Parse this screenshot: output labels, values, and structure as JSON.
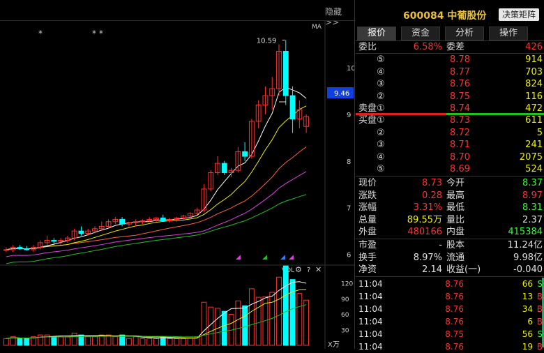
{
  "chart": {
    "hide_label": "隐藏>>",
    "ma_label": "MA",
    "stars": [
      "*",
      "* *"
    ],
    "max_label": "10.59",
    "current_price_box": "9.46",
    "price_axis": [
      "10",
      "9",
      "8",
      "7",
      "6"
    ],
    "vol_label": "VOL",
    "vol_axis": [
      "120",
      "90",
      "60",
      "30"
    ],
    "vol_unit": "X万",
    "colors": {
      "up": "#ff3030",
      "down": "#00ffff",
      "ma5": "#ffffff",
      "ma10": "#f0f000",
      "ma20": "#ff6040",
      "ma30": "#e040e0",
      "ma60": "#20c020",
      "blue_box": "#1040e0"
    }
  },
  "chart_data": {
    "type": "candlestick",
    "ylim": [
      5.8,
      11.0
    ],
    "candles": [
      [
        6.1,
        6.15,
        6.05,
        6.1
      ],
      [
        6.1,
        6.2,
        6.05,
        6.15
      ],
      [
        6.15,
        6.2,
        6.1,
        6.12
      ],
      [
        6.12,
        6.18,
        6.08,
        6.1
      ],
      [
        6.1,
        6.2,
        6.05,
        6.15
      ],
      [
        6.15,
        6.3,
        6.1,
        6.25
      ],
      [
        6.25,
        6.4,
        6.2,
        6.3
      ],
      [
        6.3,
        6.35,
        6.2,
        6.28
      ],
      [
        6.28,
        6.35,
        6.2,
        6.3
      ],
      [
        6.3,
        6.4,
        6.25,
        6.35
      ],
      [
        6.35,
        6.55,
        6.3,
        6.5
      ],
      [
        6.5,
        6.6,
        6.4,
        6.45
      ],
      [
        6.45,
        6.55,
        6.4,
        6.5
      ],
      [
        6.5,
        6.6,
        6.45,
        6.55
      ],
      [
        6.55,
        6.7,
        6.5,
        6.6
      ],
      [
        6.6,
        6.75,
        6.55,
        6.7
      ],
      [
        6.7,
        6.8,
        6.65,
        6.75
      ],
      [
        6.75,
        6.8,
        6.6,
        6.65
      ],
      [
        6.65,
        6.7,
        6.6,
        6.68
      ],
      [
        6.68,
        6.75,
        6.6,
        6.7
      ],
      [
        6.7,
        6.75,
        6.65,
        6.72
      ],
      [
        6.72,
        6.8,
        6.7,
        6.75
      ],
      [
        6.75,
        6.8,
        6.7,
        6.78
      ],
      [
        6.78,
        6.85,
        6.7,
        6.72
      ],
      [
        6.72,
        6.78,
        6.68,
        6.75
      ],
      [
        6.75,
        6.8,
        6.7,
        6.78
      ],
      [
        6.78,
        6.85,
        6.75,
        6.82
      ],
      [
        6.82,
        6.9,
        6.78,
        6.88
      ],
      [
        6.88,
        7.0,
        6.85,
        6.95
      ],
      [
        6.95,
        7.5,
        6.9,
        7.4
      ],
      [
        7.4,
        7.8,
        7.35,
        7.75
      ],
      [
        7.75,
        8.1,
        7.7,
        7.95
      ],
      [
        7.95,
        8.0,
        7.7,
        7.75
      ],
      [
        7.75,
        7.85,
        7.65,
        7.8
      ],
      [
        7.8,
        8.3,
        7.75,
        8.2
      ],
      [
        8.2,
        8.4,
        8.0,
        8.1
      ],
      [
        8.1,
        8.9,
        8.05,
        8.85
      ],
      [
        8.85,
        9.3,
        8.7,
        9.2
      ],
      [
        9.2,
        9.6,
        9.0,
        9.4
      ],
      [
        9.4,
        9.8,
        9.1,
        9.55
      ],
      [
        9.55,
        10.5,
        9.4,
        10.35
      ],
      [
        10.35,
        10.59,
        9.2,
        9.4
      ],
      [
        9.4,
        9.6,
        8.6,
        8.9
      ],
      [
        8.9,
        9.3,
        8.7,
        9.1
      ],
      [
        8.74,
        9.0,
        8.6,
        8.95
      ]
    ]
  },
  "quote": {
    "code_name": "600084 中葡股份",
    "strategy_btn": "决策矩阵",
    "tabs": [
      "报价",
      "资金",
      "分析",
      "操作"
    ],
    "weibi_label": "委比",
    "weibi_val": "6.58%",
    "weicha_label": "委差",
    "weicha_val": "426",
    "asks": [
      {
        "label": "⑤",
        "price": "8.78",
        "vol": "914"
      },
      {
        "label": "④",
        "price": "8.77",
        "vol": "703"
      },
      {
        "label": "③",
        "price": "8.76",
        "vol": "824"
      },
      {
        "label": "②",
        "price": "8.75",
        "vol": "116"
      },
      {
        "label": "卖盘①",
        "price": "8.74",
        "vol": "472"
      }
    ],
    "bids": [
      {
        "label": "买盘①",
        "price": "8.73",
        "vol": "611"
      },
      {
        "label": "②",
        "price": "8.72",
        "vol": "5"
      },
      {
        "label": "③",
        "price": "8.71",
        "vol": "241"
      },
      {
        "label": "④",
        "price": "8.70",
        "vol": "2075"
      },
      {
        "label": "⑤",
        "price": "8.69",
        "vol": "524"
      }
    ],
    "stats": [
      {
        "l1": "现价",
        "v1": "8.73",
        "c1": "red",
        "l2": "今开",
        "v2": "8.37",
        "c2": "green"
      },
      {
        "l1": "涨跌",
        "v1": "0.28",
        "c1": "red",
        "l2": "最高",
        "v2": "8.97",
        "c2": "red"
      },
      {
        "l1": "涨幅",
        "v1": "3.31%",
        "c1": "red",
        "l2": "最低",
        "v2": "8.31",
        "c2": "green"
      },
      {
        "l1": "总量",
        "v1": "89.55万",
        "c1": "yellow",
        "l2": "量比",
        "v2": "2.37",
        "c2": "white"
      },
      {
        "l1": "外盘",
        "v1": "480166",
        "c1": "red",
        "l2": "内盘",
        "v2": "415384",
        "c2": "green"
      }
    ],
    "stats2": [
      {
        "l1": "市盈",
        "v1": "-",
        "l2": "股本",
        "v2": "11.24亿"
      },
      {
        "l1": "换手",
        "v1": "8.97%",
        "l2": "流通",
        "v2": "9.98亿"
      },
      {
        "l1": "净资",
        "v1": "2.14",
        "l2": "收益(一)",
        "v2": "-0.040"
      }
    ],
    "ticks": [
      {
        "time": "11:04",
        "price": "8.76",
        "vol": "66",
        "side": "S"
      },
      {
        "time": "11:04",
        "price": "8.76",
        "vol": "13",
        "side": "B"
      },
      {
        "time": "11:04",
        "price": "8.76",
        "vol": "34",
        "side": "B"
      },
      {
        "time": "11:04",
        "price": "8.76",
        "vol": "6",
        "side": "B"
      },
      {
        "time": "11:04",
        "price": "8.75",
        "vol": "56",
        "side": "S"
      },
      {
        "time": "11:04",
        "price": "8.76",
        "vol": "19",
        "side": "B"
      }
    ]
  }
}
